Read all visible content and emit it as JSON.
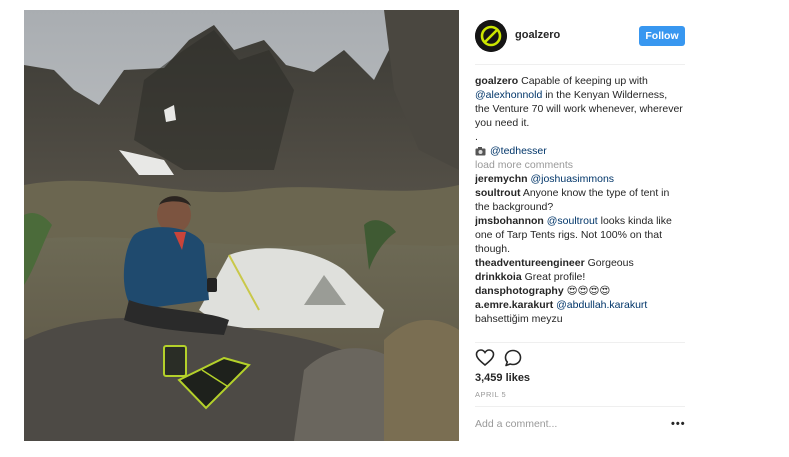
{
  "post": {
    "username": "goalzero",
    "follow_label": "Follow",
    "caption_user": "goalzero",
    "caption_part1": "Capable of keeping up with",
    "caption_mention": "@alexhonnold",
    "caption_part2": "in the Kenyan Wilderness, the Venture 70 will work whenever, wherever you need it.",
    "caption_dot": ".",
    "photo_credit": "@tedhesser",
    "load_more": "load more comments",
    "likes": "3,459 likes",
    "date": "APRIL 5",
    "add_comment_placeholder": "Add a comment...",
    "more_label": "•••"
  },
  "comments": [
    {
      "user": "jeremychn",
      "mention": "@joshuasimmons",
      "text": ""
    },
    {
      "user": "soultrout",
      "mention": "",
      "text": "Anyone know the type of tent in the background?"
    },
    {
      "user": "jmsbohannon",
      "mention": "@soultrout",
      "text": "looks kinda like one of Tarp Tents rigs. Not 100% on that though."
    },
    {
      "user": "theadventureengineer",
      "mention": "",
      "text": "Gorgeous"
    },
    {
      "user": "drinkkoia",
      "mention": "",
      "text": "Great profile!"
    },
    {
      "user": "dansphotography",
      "mention": "",
      "text": "😍😍😍😍"
    },
    {
      "user": "a.emre.karakurt",
      "mention": "@abdullah.karakurt",
      "text": ""
    },
    {
      "user": "",
      "mention": "",
      "text": "bahsettiğim meyzu"
    }
  ],
  "icons": {
    "like": "heart-icon",
    "comment": "comment-icon",
    "camera": "camera-icon",
    "logo": "goalzero-logo",
    "accent": "#3897f0"
  }
}
